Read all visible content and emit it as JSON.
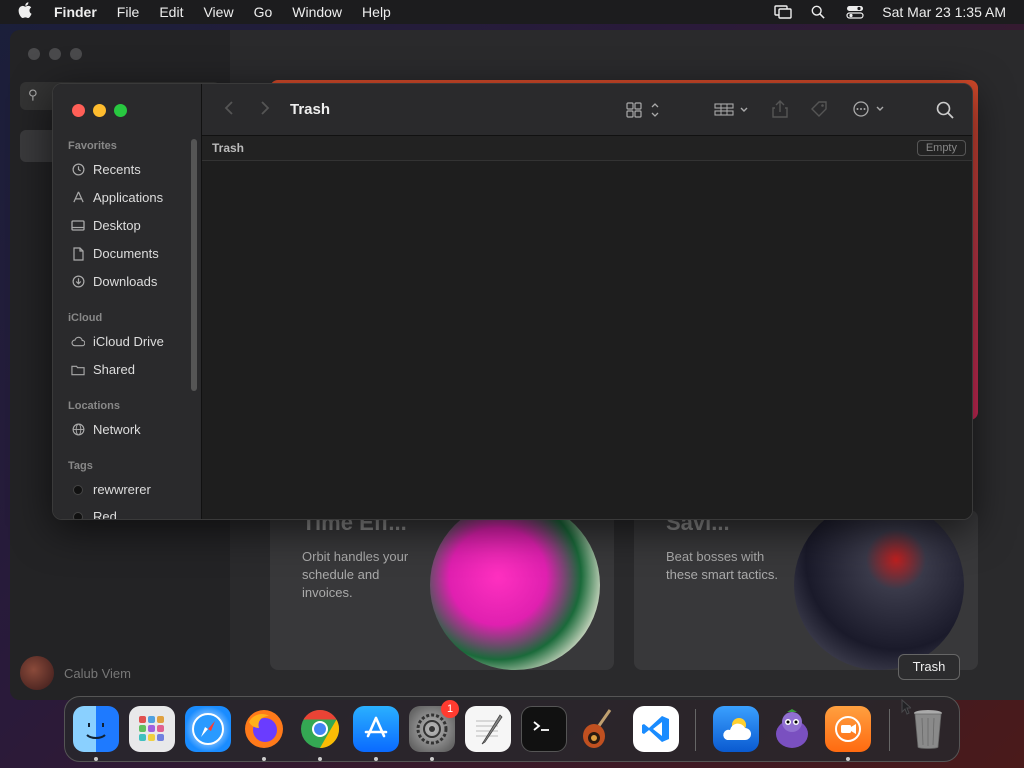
{
  "menubar": {
    "app_name": "Finder",
    "items": [
      "File",
      "Edit",
      "View",
      "Go",
      "Window",
      "Help"
    ],
    "clock": "Sat Mar 23  1:35 AM"
  },
  "background_app": {
    "user_name": "Calub Viem",
    "cards": [
      {
        "title": "Time Eff...",
        "description": "Orbit handles your schedule and invoices."
      },
      {
        "title": "Savi...",
        "description": "Beat bosses with these smart tactics."
      }
    ]
  },
  "finder": {
    "title": "Trash",
    "path_label": "Trash",
    "empty_button": "Empty",
    "sections": {
      "favorites": "Favorites",
      "icloud": "iCloud",
      "locations": "Locations",
      "tags": "Tags"
    },
    "favorites": [
      {
        "label": "Recents",
        "icon": "clock-icon"
      },
      {
        "label": "Applications",
        "icon": "applications-icon"
      },
      {
        "label": "Desktop",
        "icon": "desktop-icon"
      },
      {
        "label": "Documents",
        "icon": "document-icon"
      },
      {
        "label": "Downloads",
        "icon": "download-icon"
      }
    ],
    "icloud": [
      {
        "label": "iCloud Drive",
        "icon": "cloud-icon"
      },
      {
        "label": "Shared",
        "icon": "shared-folder-icon"
      }
    ],
    "locations": [
      {
        "label": "Network",
        "icon": "globe-icon"
      }
    ],
    "tags": [
      {
        "label": "rewwrerer",
        "color": "#000000"
      },
      {
        "label": "Red",
        "color": "#000000"
      }
    ]
  },
  "tooltip": "Trash",
  "dock": {
    "apps": [
      {
        "name": "finder-icon",
        "color": "#1e90ff",
        "running": true
      },
      {
        "name": "launchpad-icon",
        "color": "#e0e0e0",
        "running": false
      },
      {
        "name": "safari-icon",
        "color": "#1a8cff",
        "running": false
      },
      {
        "name": "firefox-icon",
        "color": "#7a3cff",
        "running": true
      },
      {
        "name": "chrome-icon",
        "color": "#ffffff",
        "running": true
      },
      {
        "name": "app-store-icon",
        "color": "#1a8cff",
        "running": true
      },
      {
        "name": "system-settings-icon",
        "color": "#8a8a8a",
        "running": true,
        "badge": "1"
      },
      {
        "name": "textedit-icon",
        "color": "#f4f4f4",
        "running": false
      },
      {
        "name": "terminal-icon",
        "color": "#111111",
        "running": false
      },
      {
        "name": "garageband-icon",
        "color": "#5a3a2a",
        "running": false
      },
      {
        "name": "vscode-icon",
        "color": "#ffffff",
        "running": false
      },
      {
        "name": "weather-icon",
        "color": "#1a7ad4",
        "running": false
      },
      {
        "name": "game-character-icon",
        "color": "#6a4aa0",
        "running": false
      },
      {
        "name": "screen-recorder-icon",
        "color": "#ff8a2a",
        "running": true
      },
      {
        "name": "trash-icon",
        "color": "#8a8a8a",
        "running": false
      }
    ]
  }
}
